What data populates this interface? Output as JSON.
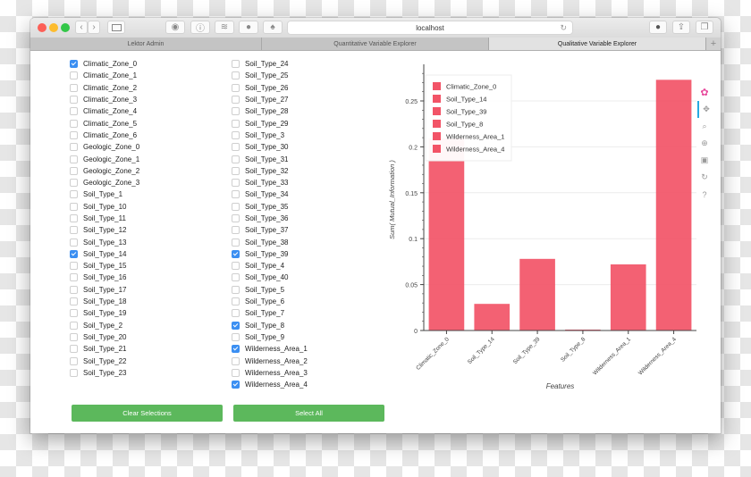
{
  "browser": {
    "url": "localhost",
    "tabs": [
      {
        "label": "Lektor Admin",
        "active": false
      },
      {
        "label": "Quantitative Variable Explorer",
        "active": false
      },
      {
        "label": "Qualitative Variable Explorer",
        "active": true
      }
    ],
    "new_tab": "+",
    "back": "‹",
    "forward": "›",
    "reload": "↻"
  },
  "checkboxes": {
    "column1": [
      {
        "label": "Climatic_Zone_0",
        "checked": true
      },
      {
        "label": "Climatic_Zone_1",
        "checked": false
      },
      {
        "label": "Climatic_Zone_2",
        "checked": false
      },
      {
        "label": "Climatic_Zone_3",
        "checked": false
      },
      {
        "label": "Climatic_Zone_4",
        "checked": false
      },
      {
        "label": "Climatic_Zone_5",
        "checked": false
      },
      {
        "label": "Climatic_Zone_6",
        "checked": false
      },
      {
        "label": "Geologic_Zone_0",
        "checked": false
      },
      {
        "label": "Geologic_Zone_1",
        "checked": false
      },
      {
        "label": "Geologic_Zone_2",
        "checked": false
      },
      {
        "label": "Geologic_Zone_3",
        "checked": false
      },
      {
        "label": "Soil_Type_1",
        "checked": false
      },
      {
        "label": "Soil_Type_10",
        "checked": false
      },
      {
        "label": "Soil_Type_11",
        "checked": false
      },
      {
        "label": "Soil_Type_12",
        "checked": false
      },
      {
        "label": "Soil_Type_13",
        "checked": false
      },
      {
        "label": "Soil_Type_14",
        "checked": true
      },
      {
        "label": "Soil_Type_15",
        "checked": false
      },
      {
        "label": "Soil_Type_16",
        "checked": false
      },
      {
        "label": "Soil_Type_17",
        "checked": false
      },
      {
        "label": "Soil_Type_18",
        "checked": false
      },
      {
        "label": "Soil_Type_19",
        "checked": false
      },
      {
        "label": "Soil_Type_2",
        "checked": false
      },
      {
        "label": "Soil_Type_20",
        "checked": false
      },
      {
        "label": "Soil_Type_21",
        "checked": false
      },
      {
        "label": "Soil_Type_22",
        "checked": false
      },
      {
        "label": "Soil_Type_23",
        "checked": false
      }
    ],
    "column2": [
      {
        "label": "Soil_Type_24",
        "checked": false
      },
      {
        "label": "Soil_Type_25",
        "checked": false
      },
      {
        "label": "Soil_Type_26",
        "checked": false
      },
      {
        "label": "Soil_Type_27",
        "checked": false
      },
      {
        "label": "Soil_Type_28",
        "checked": false
      },
      {
        "label": "Soil_Type_29",
        "checked": false
      },
      {
        "label": "Soil_Type_3",
        "checked": false
      },
      {
        "label": "Soil_Type_30",
        "checked": false
      },
      {
        "label": "Soil_Type_31",
        "checked": false
      },
      {
        "label": "Soil_Type_32",
        "checked": false
      },
      {
        "label": "Soil_Type_33",
        "checked": false
      },
      {
        "label": "Soil_Type_34",
        "checked": false
      },
      {
        "label": "Soil_Type_35",
        "checked": false
      },
      {
        "label": "Soil_Type_36",
        "checked": false
      },
      {
        "label": "Soil_Type_37",
        "checked": false
      },
      {
        "label": "Soil_Type_38",
        "checked": false
      },
      {
        "label": "Soil_Type_39",
        "checked": true
      },
      {
        "label": "Soil_Type_4",
        "checked": false
      },
      {
        "label": "Soil_Type_40",
        "checked": false
      },
      {
        "label": "Soil_Type_5",
        "checked": false
      },
      {
        "label": "Soil_Type_6",
        "checked": false
      },
      {
        "label": "Soil_Type_7",
        "checked": false
      },
      {
        "label": "Soil_Type_8",
        "checked": true
      },
      {
        "label": "Soil_Type_9",
        "checked": false
      },
      {
        "label": "Wilderness_Area_1",
        "checked": true
      },
      {
        "label": "Wilderness_Area_2",
        "checked": false
      },
      {
        "label": "Wilderness_Area_3",
        "checked": false
      },
      {
        "label": "Wilderness_Area_4",
        "checked": true
      }
    ]
  },
  "buttons": {
    "clear": "Clear Selections",
    "select_all": "Select All"
  },
  "toolbar": [
    {
      "name": "bokeh-logo-icon",
      "glyph": "✿"
    },
    {
      "name": "pan-icon",
      "glyph": "✥"
    },
    {
      "name": "box-zoom-icon",
      "glyph": "⌕"
    },
    {
      "name": "wheel-zoom-icon",
      "glyph": "⊕"
    },
    {
      "name": "save-icon",
      "glyph": "▣"
    },
    {
      "name": "reset-icon",
      "glyph": "↻"
    },
    {
      "name": "help-icon",
      "glyph": "?"
    }
  ],
  "colors": {
    "bar": "#f25467",
    "button": "#5cb85c",
    "checkbox_on": "#3b8ff2"
  },
  "chart_data": {
    "type": "bar",
    "categories": [
      "Climatic_Zone_0",
      "Soil_Type_14",
      "Soil_Type_39",
      "Soil_Type_8",
      "Wilderness_Area_1",
      "Wilderness_Area_4"
    ],
    "values": [
      0.209,
      0.029,
      0.078,
      0.001,
      0.072,
      0.273
    ],
    "xlabel": "Features",
    "ylabel": "Sum( Mutual_Information )",
    "ylim": [
      0,
      0.285
    ],
    "yticks": [
      0,
      0.05,
      0.1,
      0.15,
      0.2,
      0.25
    ],
    "ytick_labels": [
      "0",
      "0.05",
      "0.1",
      "0.15",
      "0.2",
      "0.25"
    ],
    "legend": [
      "Climatic_Zone_0",
      "Soil_Type_14",
      "Soil_Type_39",
      "Soil_Type_8",
      "Wilderness_Area_1",
      "Wilderness_Area_4"
    ],
    "legend_position": "top-left",
    "grid": true
  }
}
